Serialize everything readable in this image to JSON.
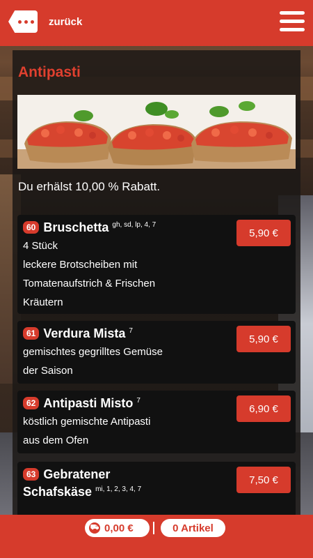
{
  "header": {
    "back_label": "zurück"
  },
  "section": {
    "title": "Antipasti",
    "discount_text": "Du erhälst 10,00 % Rabatt."
  },
  "items": [
    {
      "number": "60",
      "name": "Bruschetta",
      "allergens": "gh, sd, lp, 4, 7",
      "desc": [
        "4 Stück",
        "leckere Brotscheiben mit",
        "Tomatenaufstrich & Frischen",
        "Kräutern"
      ],
      "price": "5,90 €"
    },
    {
      "number": "61",
      "name": "Verdura Mista",
      "allergens": "7",
      "desc": [
        "gemischtes gegrilltes Gemüse",
        "der Saison"
      ],
      "price": "5,90 €"
    },
    {
      "number": "62",
      "name": "Antipasti Misto",
      "allergens": "7",
      "desc": [
        "köstlich gemischte Antipasti",
        "aus dem Ofen"
      ],
      "price": "6,90 €"
    },
    {
      "number": "63",
      "name_line1": "Gebratener",
      "name_line2": "Schafskäse",
      "allergens": "mi, 1, 2, 3, 4, 7",
      "price": "7,50 €"
    }
  ],
  "footer": {
    "cart_total": "0,00 €",
    "article_count": "0 Artikel"
  },
  "colors": {
    "accent": "#d63b2c",
    "panel": "#1c1816",
    "item_bg": "#111111"
  }
}
